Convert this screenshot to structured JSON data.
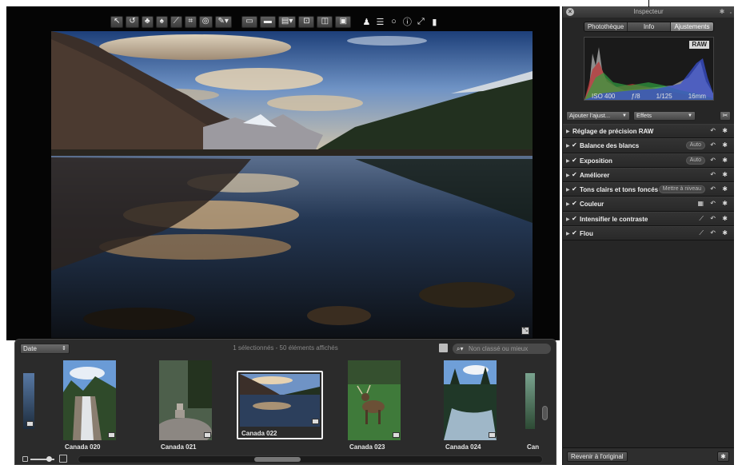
{
  "toolbar": {
    "tools": [
      "select-tool",
      "rotate-tool",
      "stamp-tool",
      "lift-tool",
      "straighten-tool",
      "crop-tool",
      "red-eye-tool",
      "brush-tool"
    ],
    "views": [
      "viewer-mode",
      "split-mode",
      "browser-mode",
      "fullscreen-mode",
      "compare-mode",
      "stack-mode"
    ],
    "extras": [
      "loupe-tool",
      "list-tool",
      "circle-tool",
      "info-tool",
      "expand-tool"
    ]
  },
  "browser": {
    "sort_label": "Date",
    "status": "1 sélectionnés - 50 éléments affichés",
    "filter_placeholder": "Non classé ou mieux",
    "thumbnails": [
      {
        "caption": "Canada 020"
      },
      {
        "caption": "Canada 021"
      },
      {
        "caption": "Canada 022",
        "selected": true
      },
      {
        "caption": "Canada 023"
      },
      {
        "caption": "Canada 024"
      },
      {
        "caption": "Can"
      }
    ]
  },
  "inspector": {
    "title": "Inspecteur",
    "tabs": [
      {
        "label": "Photothèque",
        "active": false
      },
      {
        "label": "Info",
        "active": false
      },
      {
        "label": "Ajustements",
        "active": true
      }
    ],
    "raw_badge": "RAW",
    "exif": {
      "iso": "ISO 400",
      "aperture": "ƒ/8",
      "shutter": "1/125",
      "focal": "16mm"
    },
    "add_adjustment": "Ajouter l'ajust...",
    "effects": "Effets",
    "bricks": [
      {
        "label": "Réglage de précision RAW",
        "checked": false
      },
      {
        "label": "Balance des blancs",
        "checked": true,
        "pill": "Auto"
      },
      {
        "label": "Exposition",
        "checked": true,
        "pill": "Auto"
      },
      {
        "label": "Améliorer",
        "checked": true
      },
      {
        "label": "Tons clairs et tons foncés",
        "checked": true,
        "pill": "Mettre à niveau"
      },
      {
        "label": "Couleur",
        "checked": true,
        "icon": "swatch-icon"
      },
      {
        "label": "Intensifier le contraste",
        "checked": true,
        "icon": "brush-icon"
      },
      {
        "label": "Flou",
        "checked": true,
        "icon": "brush-icon"
      }
    ],
    "revert_label": "Revenir à l'original"
  },
  "colors": {
    "panel": "#262626",
    "viewer_bg": "#050505",
    "browser_bg": "#2b2b2b",
    "active_tab": "#9a9a9a"
  }
}
